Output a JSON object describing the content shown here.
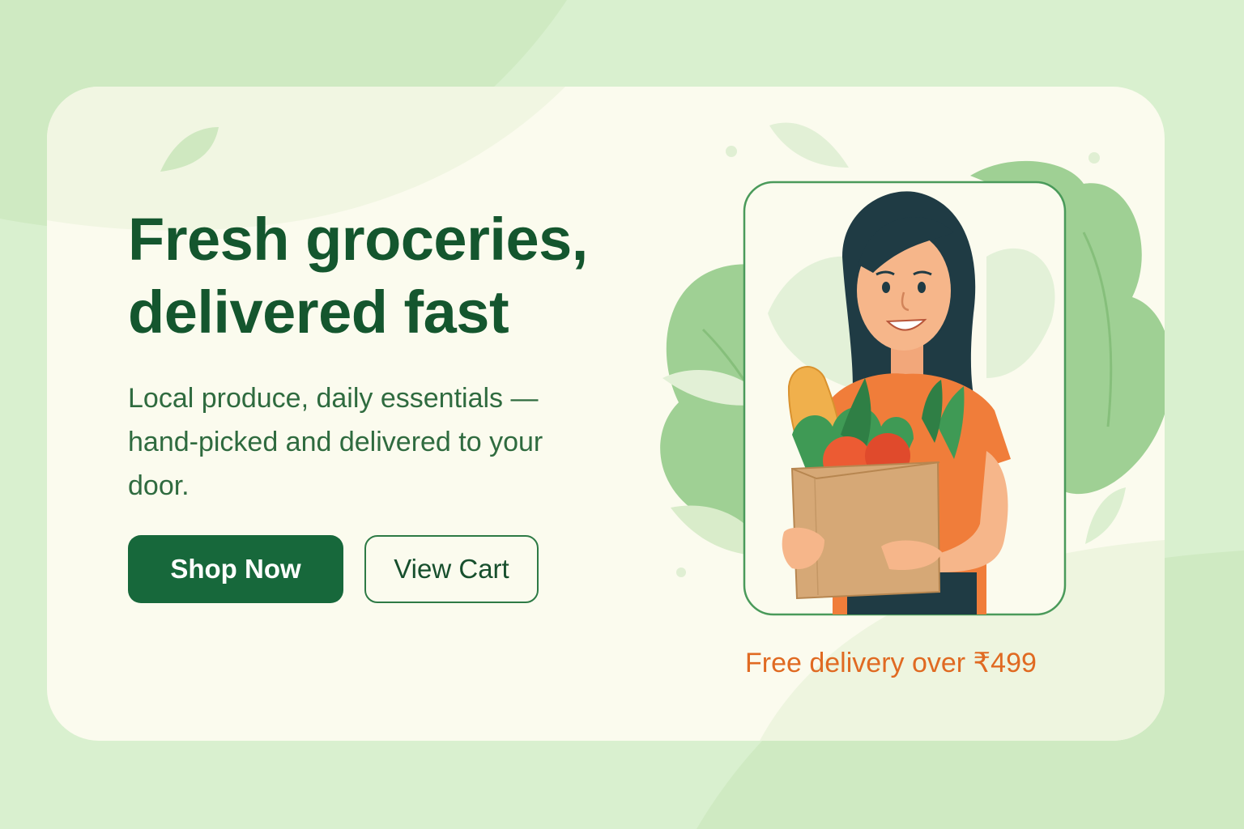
{
  "hero": {
    "headline_line1": "Fresh groceries,",
    "headline_line2": "delivered fast",
    "subtext": "Local produce, daily essentials — hand-picked and delivered to your door."
  },
  "buttons": {
    "primary_label": "Shop Now",
    "secondary_label": "View Cart"
  },
  "promo": {
    "text": "Free delivery over ₹499"
  },
  "colors": {
    "page_background": "#d9f0cf",
    "card_background": "#fbfbee",
    "headline": "#14562e",
    "primary_button": "#17683b",
    "accent_orange": "#e06a22",
    "leaf_green": "#8fcb82"
  },
  "illustration": {
    "subject": "woman holding grocery bag",
    "icons": [
      "leaf-icon",
      "bread-icon",
      "tomato-icon",
      "lettuce-icon",
      "grocery-bag-icon"
    ]
  }
}
